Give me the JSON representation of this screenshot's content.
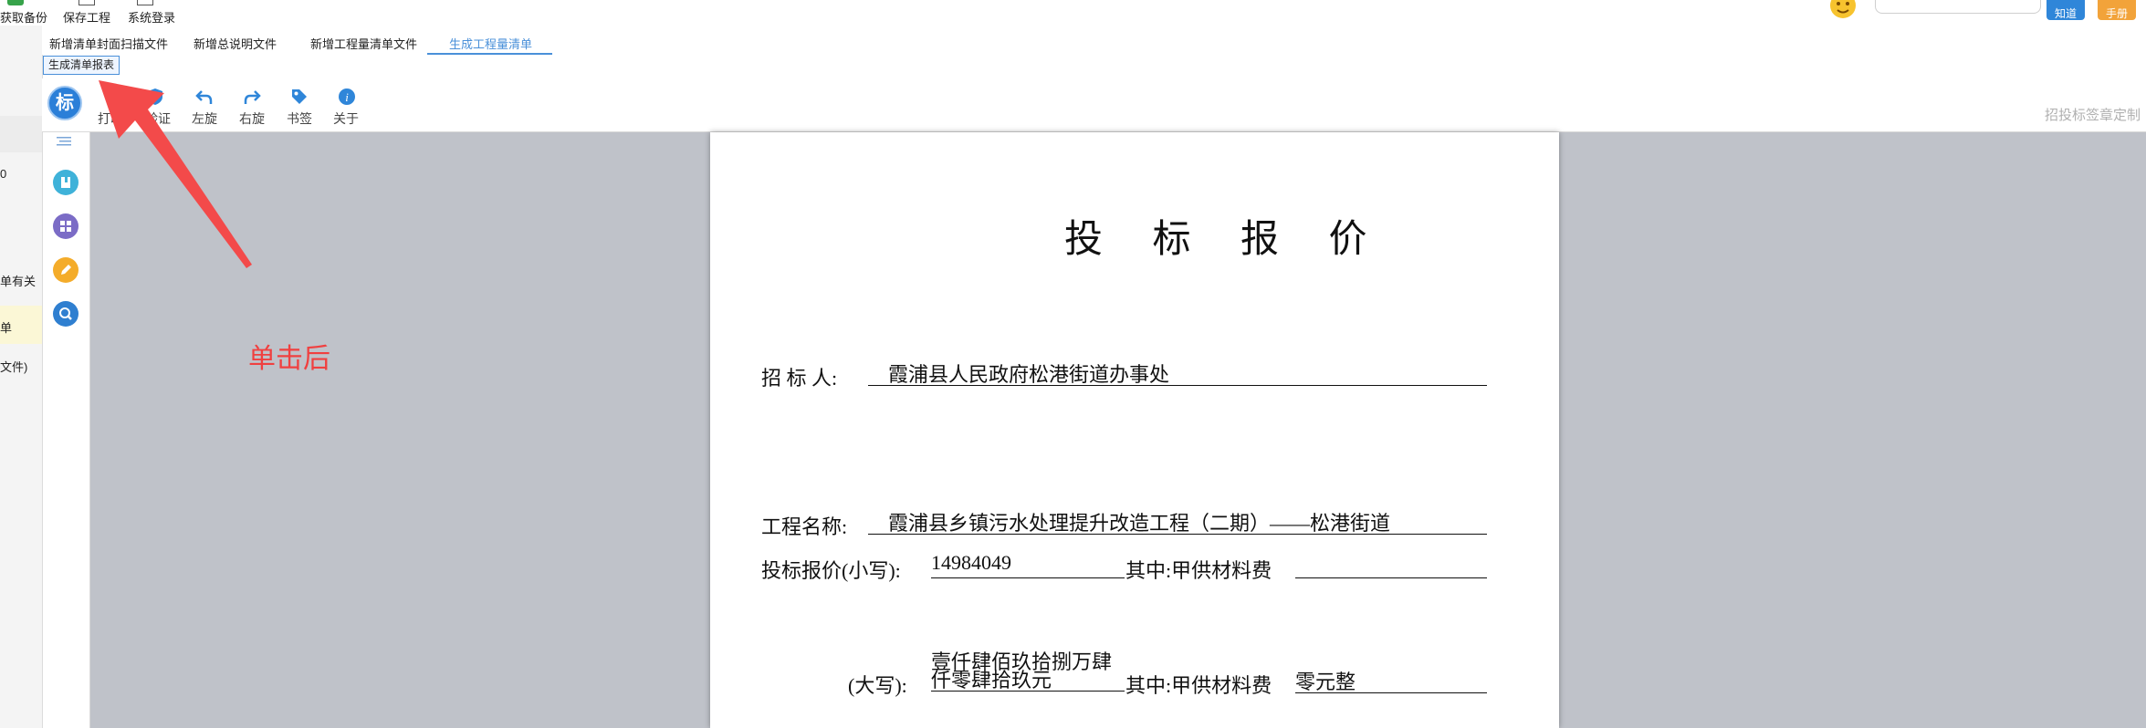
{
  "menu": {
    "items": [
      "获取备份",
      "保存工程",
      "系统登录"
    ],
    "help_buttons": [
      "知道",
      "手册"
    ]
  },
  "left_strip": {
    "items": [
      "0",
      "单有关",
      "单",
      "文件)"
    ]
  },
  "tabs": {
    "items": [
      "新增清单封面扫描文件",
      "新增总说明文件",
      "新增工程量清单文件",
      "生成工程量清单"
    ],
    "active": "生成工程量清单",
    "sub_button": "生成清单报表"
  },
  "toolbar": {
    "logo_char": "标",
    "buttons": [
      "打印",
      "验证",
      "左旋",
      "右旋",
      "书签",
      "关于"
    ],
    "brand": "招投标签章定制"
  },
  "side_rail": {
    "icons": [
      "list-icon",
      "bookmark-icon",
      "grid-icon",
      "pen-icon",
      "search-icon"
    ]
  },
  "document": {
    "title": "投 标 报 价",
    "bidder_label": "招 标 人:",
    "bidder_value": "霞浦县人民政府松港街道办事处",
    "project_label": "工程名称:",
    "project_value": "霞浦县乡镇污水处理提升改造工程（二期）——松港街道",
    "price_small_label": "投标报价(小写):",
    "price_small_value": "14984049",
    "supply_label_1": "其中:甲供材料费",
    "supply_value_1": "",
    "price_big_label": "(大写):",
    "price_big_line1": "壹仟肆佰玖拾捌万肆",
    "price_big_line2": "仟零肆拾玖元",
    "supply_label_2": "其中:甲供材料费",
    "supply_value_2": "零元整"
  },
  "annotation": {
    "text": "单击后"
  },
  "colors": {
    "accent_blue": "#4a90d9",
    "annotation_red": "#f04040",
    "viewer_bg": "#bfc2c9",
    "highlight_yellow": "#fbf7d6"
  }
}
